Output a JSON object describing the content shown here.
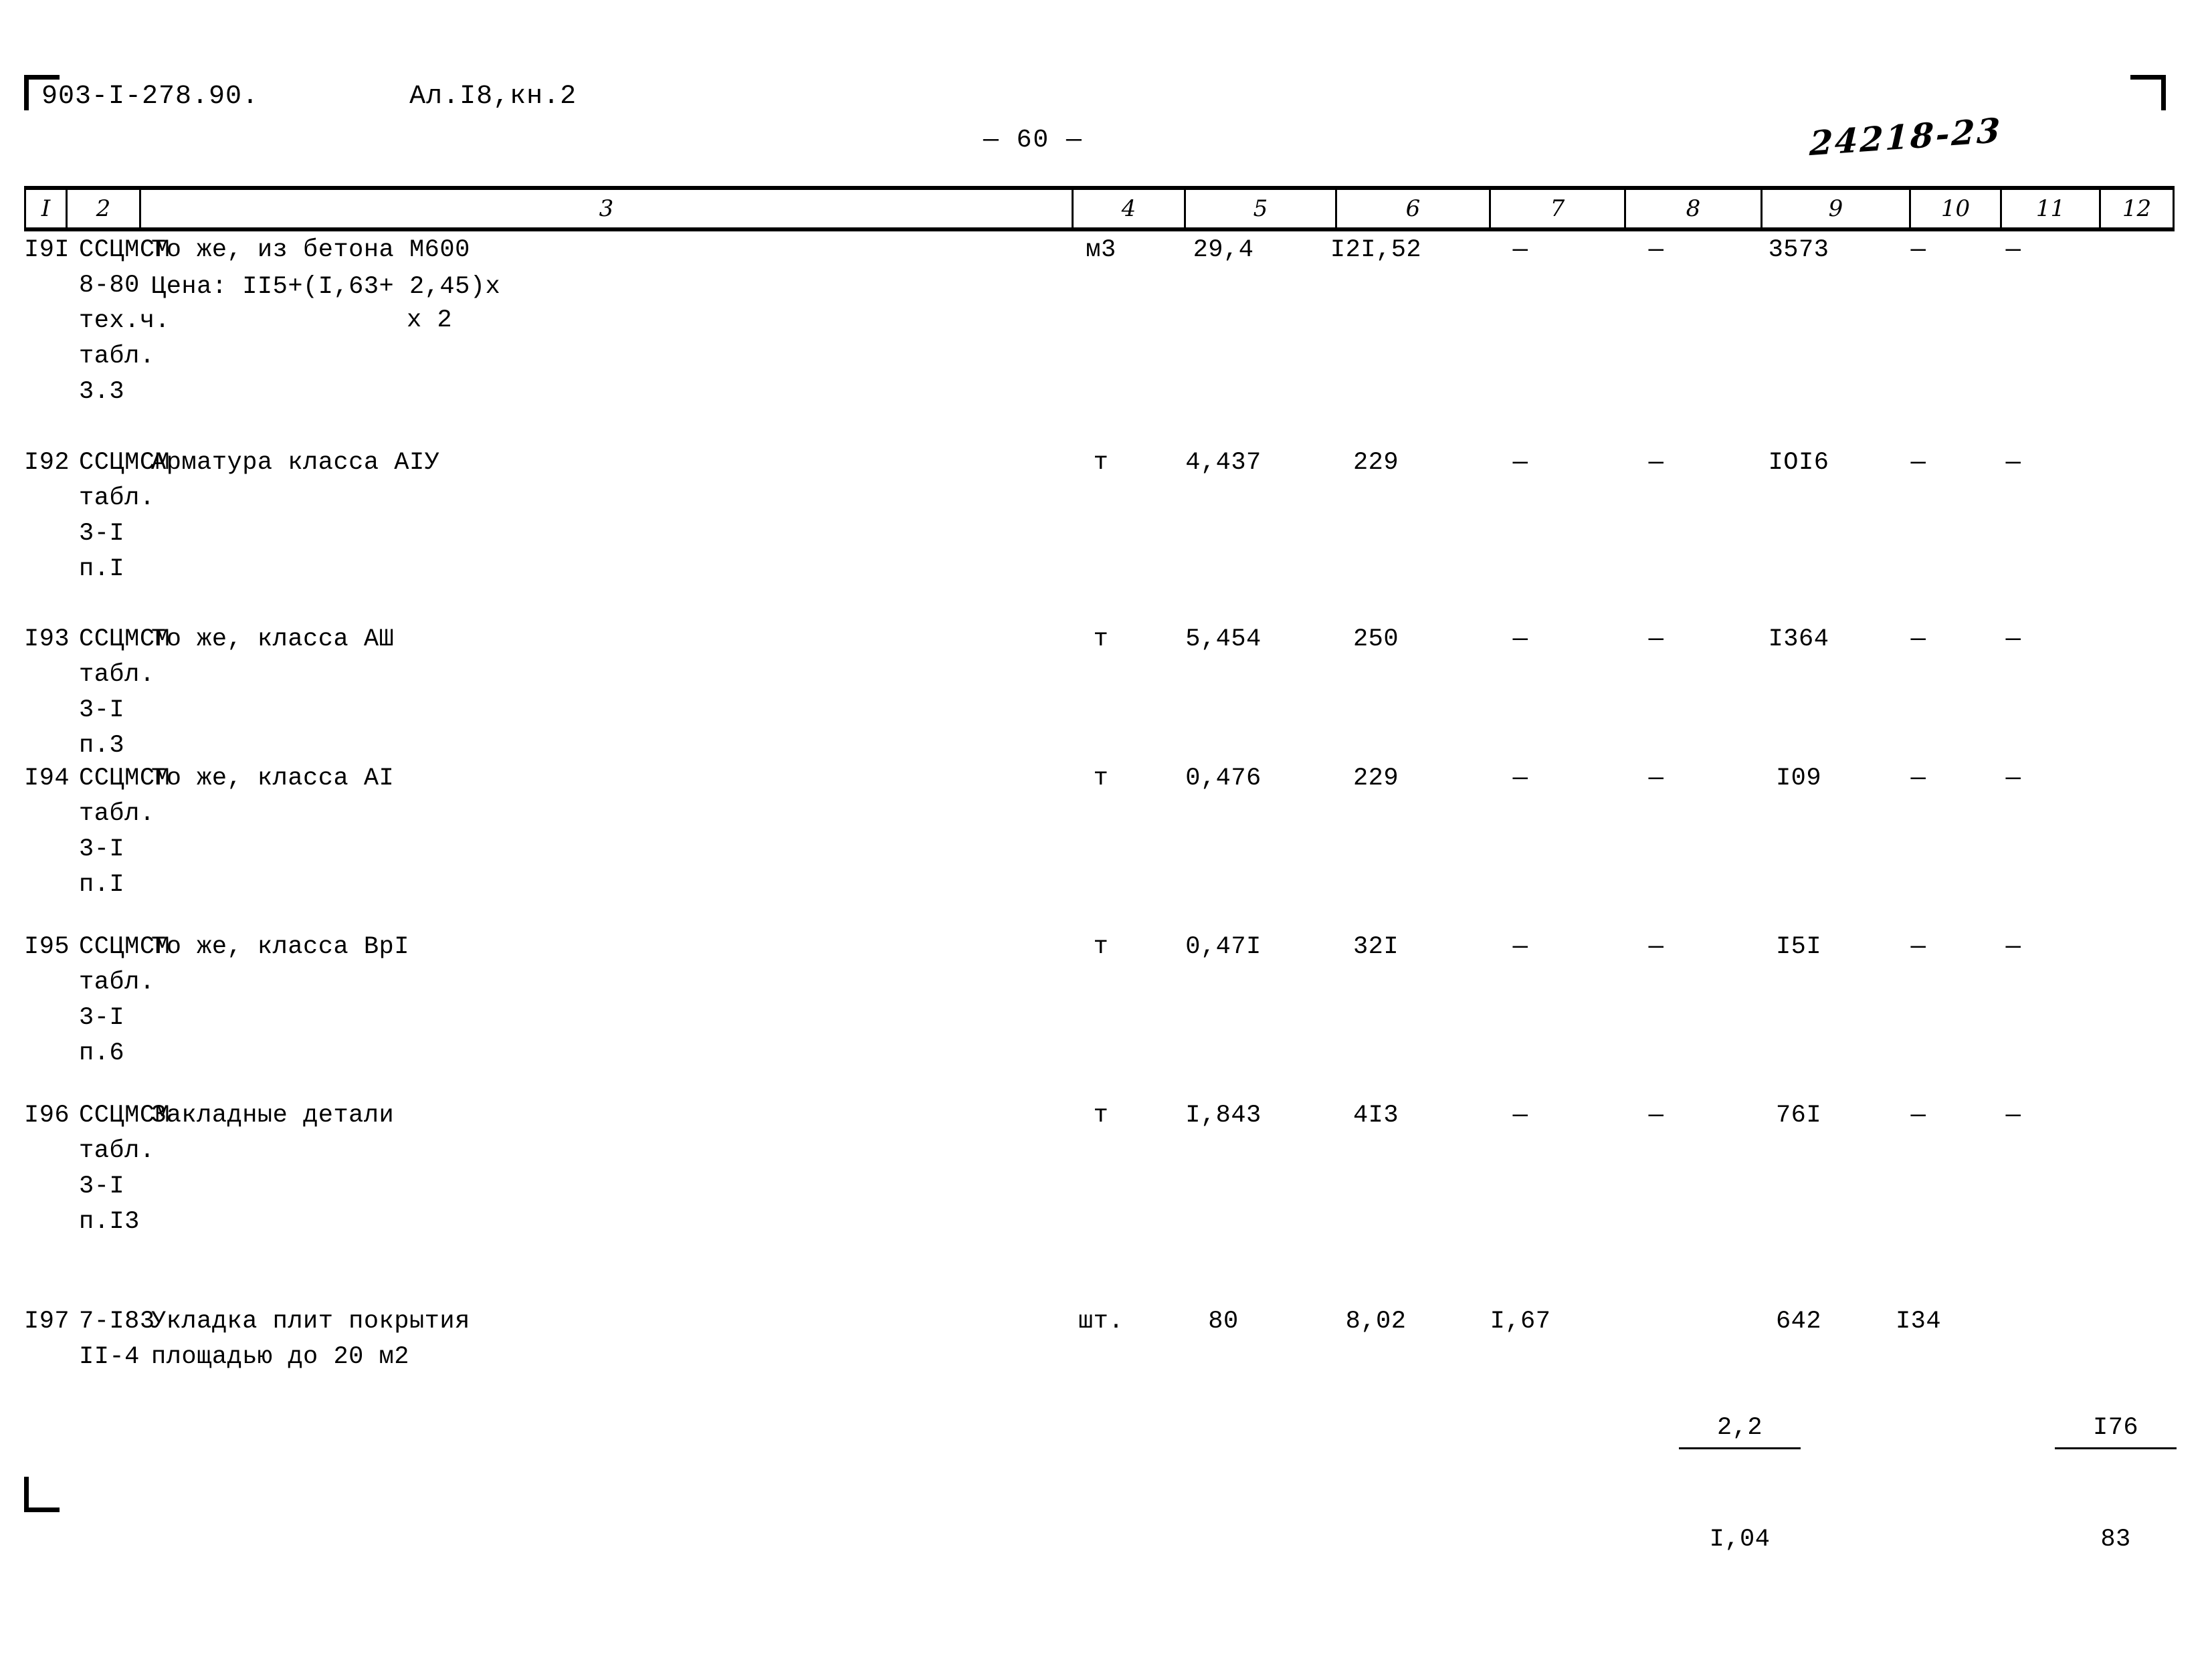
{
  "header": {
    "doc_code": "903-I-278.90.",
    "album": "Ал.I8,кн.2",
    "page_number": "—  60 —",
    "archive_number": "24218-23"
  },
  "table": {
    "column_headers": [
      "I",
      "2",
      "3",
      "4",
      "5",
      "6",
      "7",
      "8",
      "9",
      "10",
      "11",
      "12"
    ],
    "rows": [
      {
        "c1": "I9I",
        "c2": "ССЦМСМ\n8-80\nтех.ч.\nтабл.\n3.3",
        "c3_line1": "То же, из бетона М600",
        "c3_line2": "Цена: II5+(I,63+ 2,45)х",
        "c3_line3": "х 2",
        "c4": "м3",
        "c5": "29,4",
        "c6": "I2I,52",
        "c7": "—",
        "c8": "—",
        "c9": "3573",
        "c10": "—",
        "c11": "—",
        "c12": ""
      },
      {
        "c1": "I92",
        "c2": "ССЦМСМ\nтабл.\n3-I\nп.I",
        "c3_line1": "Арматура класса АIУ",
        "c3_line2": "",
        "c3_line3": "",
        "c4": "т",
        "c5": "4,437",
        "c6": "229",
        "c7": "—",
        "c8": "—",
        "c9": "IOI6",
        "c10": "—",
        "c11": "—",
        "c12": ""
      },
      {
        "c1": "I93",
        "c2": "ССЦМСМ\nтабл.\n3-I\nп.3",
        "c3_line1": "То же, класса АШ",
        "c3_line2": "",
        "c3_line3": "",
        "c4": "т",
        "c5": "5,454",
        "c6": "250",
        "c7": "—",
        "c8": "—",
        "c9": "I364",
        "c10": "—",
        "c11": "—",
        "c12": ""
      },
      {
        "c1": "I94",
        "c2": "ССЦМСМ\nтабл.\n3-I\nп.I",
        "c3_line1": "То же, класса АI",
        "c3_line2": "",
        "c3_line3": "",
        "c4": "т",
        "c5": "0,476",
        "c6": "229",
        "c7": "—",
        "c8": "—",
        "c9": "I09",
        "c10": "—",
        "c11": "—",
        "c12": ""
      },
      {
        "c1": "I95",
        "c2": "ССЦМСМ\nтабл.\n3-I\nп.6",
        "c3_line1": "То же, класса ВрI",
        "c3_line2": "",
        "c3_line3": "",
        "c4": "т",
        "c5": "0,47I",
        "c6": "32I",
        "c7": "—",
        "c8": "—",
        "c9": "I5I",
        "c10": "—",
        "c11": "—",
        "c12": ""
      },
      {
        "c1": "I96",
        "c2": "ССЦМСМ\nтабл.\n3-I\nп.I3",
        "c3_line1": "Закладные детали",
        "c3_line2": "",
        "c3_line3": "",
        "c4": "т",
        "c5": "I,843",
        "c6": "4I3",
        "c7": "—",
        "c8": "—",
        "c9": "76I",
        "c10": "—",
        "c11": "—",
        "c12": ""
      },
      {
        "c1": "I97",
        "c2": "7-I83\nII-4",
        "c3_line1": "Укладка плит покрытия",
        "c3_line2": "площадью до 20 м2",
        "c3_line3": "",
        "c4": "шт.",
        "c5": "80",
        "c6": "8,02",
        "c7": "I,67",
        "c8_top": "2,2",
        "c8_bot": "I,04",
        "c9": "642",
        "c10": "I34",
        "c11_top": "I76",
        "c11_bot": "83",
        "c12": ""
      }
    ]
  }
}
